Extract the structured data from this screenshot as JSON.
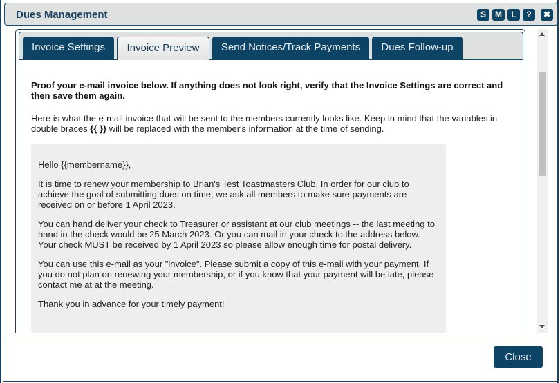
{
  "window": {
    "title": "Dues Management",
    "buttons": [
      {
        "label": "S",
        "name": "size-small-button"
      },
      {
        "label": "M",
        "name": "size-medium-button"
      },
      {
        "label": "L",
        "name": "size-large-button"
      },
      {
        "label": "?",
        "name": "help-button"
      },
      {
        "label": "✖",
        "name": "close-window-button"
      }
    ]
  },
  "tabs": [
    {
      "label": "Invoice Settings",
      "active": false
    },
    {
      "label": "Invoice Preview",
      "active": true
    },
    {
      "label": "Send Notices/Track Payments",
      "active": false
    },
    {
      "label": "Dues Follow-up",
      "active": false
    }
  ],
  "preview": {
    "instruction_bold": "Proof your e-mail invoice below. If anything does not look right, verify that the Invoice Settings are correct and then save them again.",
    "intro_before": "Here is what the e-mail invoice that will be sent to the members currently looks like. Keep in mind that the variables in double braces ",
    "intro_braces": "{{ }}",
    "intro_after": " will be replaced with the member's information at the time of sending.",
    "email_paragraphs": [
      "Hello {{membername}},",
      "It is time to renew your membership to Brian's Test Toastmasters Club. In order for our club to achieve the goal of submitting dues on time, we ask all members to make sure payments are received on or before 1 April 2023.",
      "You can hand deliver your check to Treasurer or assistant at our club meetings -- the last meeting to hand in the check would be 25 March 2023. Or you can mail in your check to the address below. Your check MUST be received by 1 April 2023 so please allow enough time for postal delivery.",
      "You can use this e-mail as your \"invoice\". Please submit a copy of this e-mail with your payment. If you do not plan on renewing your membership, or if you know that your payment will be late, please contact me at at the meeting.",
      "Thank you in advance for your timely payment!"
    ]
  },
  "footer": {
    "close_label": "Close"
  }
}
